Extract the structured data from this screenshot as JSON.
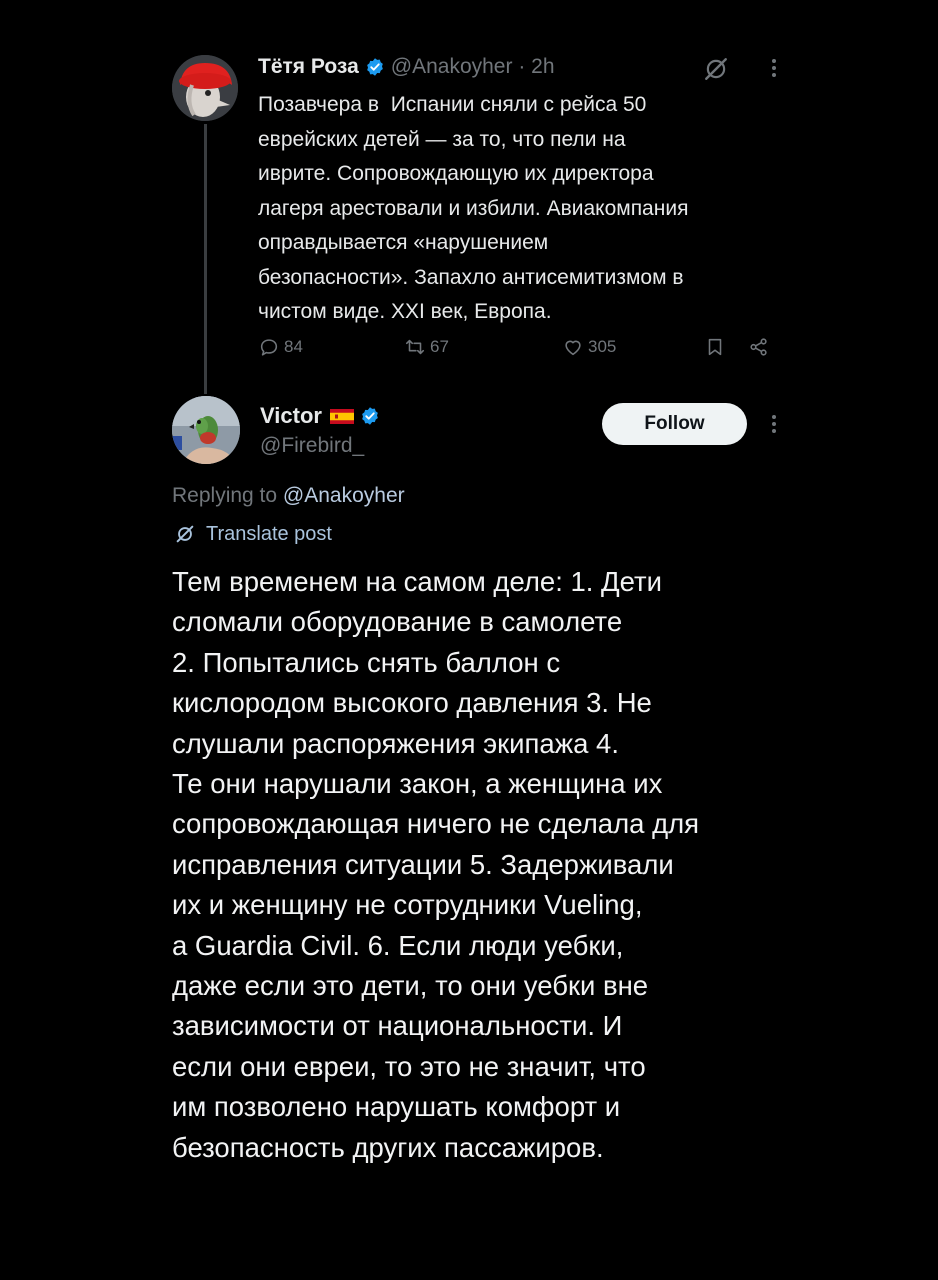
{
  "parent": {
    "name": "Тётя Роза",
    "handle_time": "@Anakoyher · 2h",
    "text": "Позавчера в  Испании сняли с рейса 50\nеврейских детей — за то, что пели на\nиврите. Сопровождающую их директора\nлагеря арестовали и избили. Авиакомпания\nоправдывается «нарушением\nбезопасности». Запахло антисемитизмом в\nчистом виде. XXI век, Европа.",
    "replies": "84",
    "reposts": "67",
    "likes": "305",
    "icons": [
      "grok-icon",
      "more-icon",
      "reply-icon",
      "repost-icon",
      "like-icon",
      "bookmark-icon",
      "share-icon",
      "verified-badge-icon"
    ]
  },
  "reply": {
    "name": "Victor",
    "handle": "@Firebird_",
    "follow_label": "Follow",
    "replying_prefix": "Replying to ",
    "replying_mention": "@Anakoyher",
    "translate_label": "Translate post",
    "text": "Тем временем на самом деле: 1. Дети\nсломали оборудование в самолете\n2. Попытались снять баллон с\nкислородом высокого давления 3. Не\nслушали распоряжения экипажа 4.\nТе они нарушали закон, а женщина их\nсопровождающая ничего не сделала для\nисправления ситуации 5. Задерживали\nих и женщину не сотрудники Vueling,\nа Guardia Civil. 6. Если люди уебки,\nдаже если это дети, то они уебки вне\nзависимости от национальности. И\nесли они евреи, то это не значит, что\nим позволено нарушать комфорт и\nбезопасность других пассажиров.",
    "icons": [
      "spain-flag-icon",
      "verified-badge-icon",
      "more-icon",
      "translate-icon"
    ]
  },
  "colors": {
    "background": "#000000",
    "text": "#e7e9ea",
    "secondary": "#71767b",
    "verified": "#1d9bf0",
    "follow_bg": "#eff3f4"
  }
}
